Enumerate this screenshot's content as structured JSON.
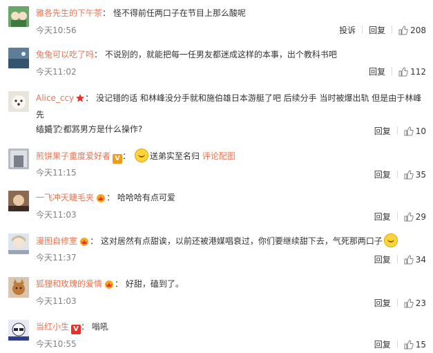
{
  "actions": {
    "report": "投诉",
    "reply": "回复"
  },
  "comments": [
    {
      "username": "雅各先生的下午茶",
      "sep": "：",
      "text": "怪不得前任两口子在节目上那么酸呢",
      "time": "今天10:56",
      "likes": "208",
      "report": true
    },
    {
      "username": "兔兔可以吃了吗",
      "sep": "：",
      "text": "不说别的，就能把每一任男友都迷成这样的本事，出个教科书吧",
      "time": "今天11:02",
      "likes": "112"
    },
    {
      "username": "Alice_ccy",
      "sep": "：",
      "text_line1": "没记错的话 和林峰没分手就和施伯雄日本游艇了吧 后续分手 当时被爆出轨 但是由于林峰先",
      "text_line2": "结婚了 都骂男方是什么操作?",
      "time": "今天12:12",
      "likes": "10"
    },
    {
      "username": "煎饼果子重度爱好者",
      "sep": "：",
      "text": "送弟实至名归",
      "link": "评论配图",
      "time": "今天11:15",
      "likes": "35"
    },
    {
      "username": "一飞冲天睫毛夹",
      "sep": "：",
      "text": "哈哈哈有点可爱",
      "time": "今天11:03",
      "likes": "29"
    },
    {
      "username": "漫图自修室",
      "sep": "：",
      "text": "这对居然有点甜诶，以前还被港媒唱衰过，你们要继续甜下去，气死那两口子",
      "time": "今天11:37",
      "likes": "34"
    },
    {
      "username": "狐狸和玫瑰的爱情",
      "sep": "：",
      "text": "好甜，磕到了。",
      "time": "今天11:03",
      "likes": "23"
    },
    {
      "username": "当红小生",
      "sep": "：",
      "text": "嗡吼",
      "time": "今天10:55",
      "likes": "15"
    }
  ]
}
